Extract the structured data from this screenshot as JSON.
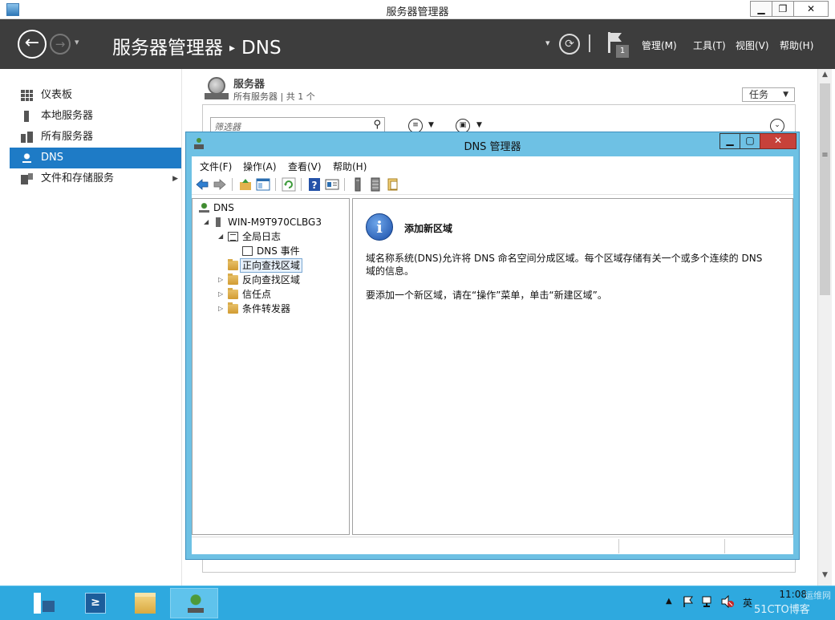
{
  "window": {
    "title": "服务器管理器",
    "min": "▁",
    "restore": "❐",
    "close": "✕"
  },
  "header": {
    "back": "←",
    "forward": "→",
    "nav_dropdown": "▾",
    "breadcrumb_root": "服务器管理器",
    "breadcrumb_sep": "▸",
    "breadcrumb_current": "DNS",
    "dropdown": "▾",
    "refresh": "⟳",
    "notification_count": "1",
    "menus": {
      "manage": "管理(M)",
      "tools": "工具(T)",
      "view": "视图(V)",
      "help": "帮助(H)"
    }
  },
  "sidebar": {
    "items": [
      {
        "label": "仪表板",
        "icon": "dashboard-icon"
      },
      {
        "label": "本地服务器",
        "icon": "server-icon"
      },
      {
        "label": "所有服务器",
        "icon": "servers-icon"
      },
      {
        "label": "DNS",
        "icon": "dns-icon"
      },
      {
        "label": "文件和存储服务",
        "icon": "files-icon",
        "chevron": "▶"
      }
    ]
  },
  "panel": {
    "title": "服务器",
    "subtitle": "所有服务器 | 共 1 个",
    "tasks": "任务",
    "caret": "▼",
    "filter_placeholder": "筛选器",
    "search_glyph": "⚲",
    "list_glyph": "≡",
    "save_glyph": "▣",
    "caret_small": "▼",
    "collapse_glyph": "⌄"
  },
  "scrollbar": {
    "up": "▲",
    "down": "▼",
    "grip": "≡"
  },
  "dns_dialog": {
    "title": "DNS 管理器",
    "min": "▁",
    "restore": "▢",
    "close": "✕",
    "menu": {
      "file": "文件(F)",
      "action": "操作(A)",
      "view": "查看(V)",
      "help": "帮助(H)"
    },
    "tree": {
      "root": "DNS",
      "server": "WIN-M9T970CLBG3",
      "global_logs": "全局日志",
      "dns_events": "DNS 事件",
      "forward_zones": "正向查找区域",
      "reverse_zones": "反向查找区域",
      "trust_points": "信任点",
      "conditional_forwarders": "条件转发器",
      "expanded": "◢",
      "collapsed": "▷"
    },
    "content": {
      "info_glyph": "i",
      "title": "添加新区域",
      "para1": "域名称系统(DNS)允许将 DNS 命名空间分成区域。每个区域存储有关一个或多个连续的 DNS 域的信息。",
      "para2": "要添加一个新区域，请在“操作”菜单，单击“新建区域”。"
    }
  },
  "taskbar": {
    "powershell_glyph": "≥",
    "tray_arrow": "▲",
    "time": "11:08",
    "watermark": "51CTO博客",
    "watermark2": "运维网",
    "ime": "英"
  },
  "colors": {
    "accent": "#1e7bc6",
    "header_bg": "#3d3d3d",
    "taskbar_bg": "#2ea9df",
    "dialog_frame": "#6ec1e4"
  }
}
